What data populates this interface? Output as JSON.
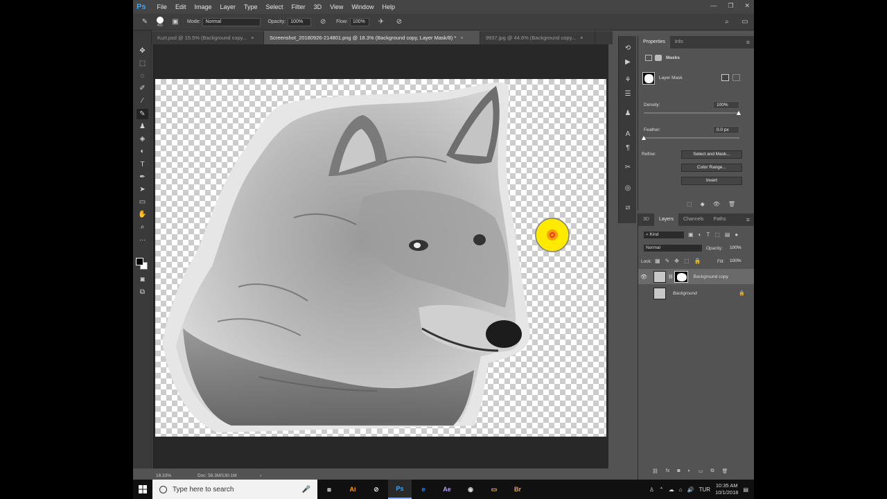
{
  "menubar": {
    "logo": "Ps",
    "items": [
      "File",
      "Edit",
      "Image",
      "Layer",
      "Type",
      "Select",
      "Filter",
      "3D",
      "View",
      "Window",
      "Help"
    ]
  },
  "options": {
    "brush_size": "401",
    "mode_label": "Mode:",
    "mode_value": "Normal",
    "opacity_label": "Opacity:",
    "opacity_value": "100%",
    "flow_label": "Flow:",
    "flow_value": "100%"
  },
  "tabs": [
    {
      "label": "Kurt.psd @ 15.5% (Background copy...",
      "close": "×"
    },
    {
      "label": "Screenshot_20180926-214801.png @ 18.3% (Background copy, Layer Mask/8) *",
      "close": "×"
    },
    {
      "label": "9937.jpg @ 44.6% (Background copy...",
      "close": "×"
    }
  ],
  "status": {
    "zoom": "18.33%",
    "doc": "Doc: 58.3M/130.1M",
    "arrow": "›"
  },
  "properties": {
    "tab_properties": "Properties",
    "tab_info": "Info",
    "masks_title": "Masks",
    "layer_mask_label": "Layer Mask",
    "density_label": "Density:",
    "density_value": "100%",
    "feather_label": "Feather:",
    "feather_value": "0.0 px",
    "refine_label": "Refine:",
    "select_mask_btn": "Select and Mask...",
    "color_range_btn": "Color Range...",
    "invert_btn": "Invert"
  },
  "layers": {
    "tab_3d": "3D",
    "tab_layers": "Layers",
    "tab_channels": "Channels",
    "tab_paths": "Paths",
    "filter_kind": "Kind",
    "blend_mode": "Normal",
    "opacity_label": "Opacity:",
    "opacity_value": "100%",
    "lock_label": "Lock:",
    "fill_label": "Fill:",
    "fill_value": "100%",
    "rows": [
      {
        "name": "Background copy"
      },
      {
        "name": "Background"
      }
    ]
  },
  "taskbar": {
    "search_placeholder": "Type here to search",
    "apps": [
      "Ai",
      "Ps",
      "e",
      "Ae",
      "Br"
    ],
    "lang": "TUR",
    "time": "10:35 AM",
    "date": "10/1/2018"
  }
}
